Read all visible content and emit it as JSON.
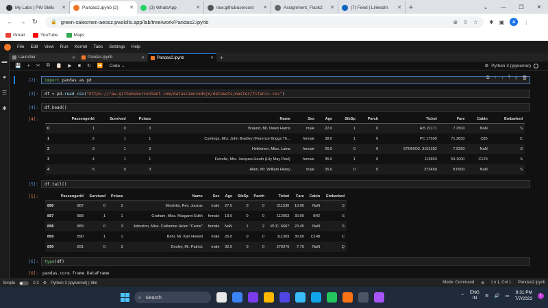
{
  "browser": {
    "tabs": [
      {
        "label": "My Labs | PW Skills",
        "color": "#333333"
      },
      {
        "label": "Pandas2.ipynb (2)",
        "color": "#f37726"
      },
      {
        "label": "(3) WhatsApp",
        "color": "#25d366"
      },
      {
        "label": "raw.githubusercont",
        "color": "#555555"
      },
      {
        "label": "Assignment_Flask2",
        "color": "#666666"
      },
      {
        "label": "(7) Feed | LinkedIn",
        "color": "#0a66c2"
      }
    ],
    "new_tab": "+",
    "url": "green-salesmen-aeosz.pwskills.app/lab/tree/work/Pandas2.ipynb",
    "profile_initial": "A",
    "bookmarks": [
      {
        "label": "Gmail",
        "color": "#ea4335"
      },
      {
        "label": "YouTube",
        "color": "#ff0000"
      },
      {
        "label": "Maps",
        "color": "#34a853"
      }
    ]
  },
  "jupyter": {
    "menu": [
      "File",
      "Edit",
      "View",
      "Run",
      "Kernel",
      "Tabs",
      "Settings",
      "Help"
    ],
    "doc_tabs": [
      "Launcher",
      "Pandas.ipynb",
      "Pandas2.ipynb"
    ],
    "cell_type": "Code",
    "kernel_name": "Python 3 (ipykernel)",
    "cells": {
      "c2": {
        "prompt": "[2]:",
        "kw": "import",
        "rest": " pandas as pd"
      },
      "c3": {
        "prompt": "[3]:",
        "pre": "df = pd.",
        "fn": "read_csv",
        "open": "(",
        "str": "\"https://raw.githubusercontent.com/datasciencedojo/datasets/master/titanic.csv\"",
        "close": ")"
      },
      "c4": {
        "prompt": "[4]:",
        "code": "df.head()",
        "out_prompt": "[4]:"
      },
      "c5": {
        "prompt": "[5]:",
        "code": "df.tail()",
        "out_prompt": "[5]:"
      },
      "c6": {
        "prompt": "[6]:",
        "fn": "type",
        "arg": "(df)",
        "out_prompt": "[6]:",
        "output": "pandas.core.frame.DataFrame"
      }
    },
    "columns": [
      "PassengerId",
      "Survived",
      "Pclass",
      "Name",
      "Sex",
      "Age",
      "SibSp",
      "Parch",
      "Ticket",
      "Fare",
      "Cabin",
      "Embarked"
    ],
    "head_rows": [
      [
        "0",
        "1",
        "0",
        "3",
        "Braund, Mr. Owen Harris",
        "male",
        "22.0",
        "1",
        "0",
        "A/5 21171",
        "7.2500",
        "NaN",
        "S"
      ],
      [
        "1",
        "2",
        "1",
        "1",
        "Cumings, Mrs. John Bradley (Florence Briggs Th...",
        "female",
        "38.0",
        "1",
        "0",
        "PC 17599",
        "71.2833",
        "C85",
        "C"
      ],
      [
        "2",
        "3",
        "1",
        "3",
        "Heikkinen, Miss. Laina",
        "female",
        "26.0",
        "0",
        "0",
        "STON/O2. 3101282",
        "7.9250",
        "NaN",
        "S"
      ],
      [
        "3",
        "4",
        "1",
        "1",
        "Futrelle, Mrs. Jacques Heath (Lily May Peel)",
        "female",
        "35.0",
        "1",
        "0",
        "113803",
        "53.1000",
        "C123",
        "S"
      ],
      [
        "4",
        "5",
        "0",
        "3",
        "Allen, Mr. William Henry",
        "male",
        "35.0",
        "0",
        "0",
        "373450",
        "8.0500",
        "NaN",
        "S"
      ]
    ],
    "tail_rows": [
      [
        "886",
        "887",
        "0",
        "2",
        "Montvila, Rev. Juozas",
        "male",
        "27.0",
        "0",
        "0",
        "211536",
        "13.00",
        "NaN",
        "S"
      ],
      [
        "887",
        "888",
        "1",
        "1",
        "Graham, Miss. Margaret Edith",
        "female",
        "19.0",
        "0",
        "0",
        "112053",
        "30.00",
        "B42",
        "S"
      ],
      [
        "888",
        "889",
        "0",
        "3",
        "Johnston, Miss. Catherine Helen \"Carrie\"",
        "female",
        "NaN",
        "1",
        "2",
        "W./C. 6607",
        "23.45",
        "NaN",
        "S"
      ],
      [
        "889",
        "890",
        "1",
        "1",
        "Behr, Mr. Karl Howell",
        "male",
        "26.0",
        "0",
        "0",
        "111369",
        "30.00",
        "C148",
        "C"
      ],
      [
        "890",
        "891",
        "0",
        "3",
        "Dooley, Mr. Patrick",
        "male",
        "32.0",
        "0",
        "0",
        "370376",
        "7.75",
        "NaN",
        "Q"
      ]
    ],
    "status": {
      "mode_label": "Simple",
      "counts": "0  2",
      "kernel": "Python 3 (ipykernel) | Idle",
      "mode": "Mode: Command",
      "position": "Ln 1, Col 1",
      "file": "Pandas2.ipynb"
    }
  },
  "taskbar": {
    "search_label": "Search",
    "pinned": [
      "#e8e8e8",
      "#3b82f6",
      "#7c3aed",
      "#ffb900",
      "#4f46e5",
      "#38bdf8",
      "#0ea5e9",
      "#22c55e",
      "#f97316",
      "#4b5563",
      "#a855f7"
    ],
    "lang_top": "ENG",
    "lang_bottom": "IN",
    "time": "8:31 PM",
    "date": "7/7/2023",
    "notif_count": "1"
  }
}
